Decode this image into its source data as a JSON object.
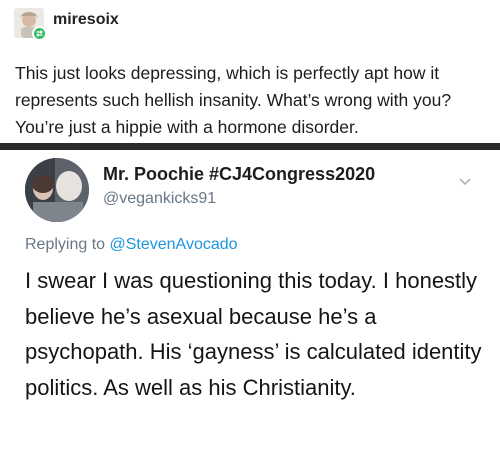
{
  "tumblr_post": {
    "username": "miresoix",
    "avatar_icon": "user-avatar-icon",
    "badge_icon": "reblog-badge-icon",
    "body": "This just looks depressing, which is perfectly apt how it represents such hellish insanity. What’s wrong with you? You’re just a hippie with a hormone disorder."
  },
  "tweet": {
    "display_name": "Mr. Poochie #CJ4Congress2020",
    "handle": "@vegankicks91",
    "menu_icon": "chevron-down-icon",
    "replying_to_label": "Replying to",
    "replying_to_user": "@StevenAvocado",
    "text": "I swear I was questioning this today. I honestly believe he’s asexual because he’s a psychopath. His ‘gayness’ is calculated identity politics. As well as his Christianity."
  },
  "colors": {
    "divider": "#2b2b2b",
    "mention": "#1b95e0",
    "secondary_text": "#687785",
    "badge": "#2fbb63"
  }
}
